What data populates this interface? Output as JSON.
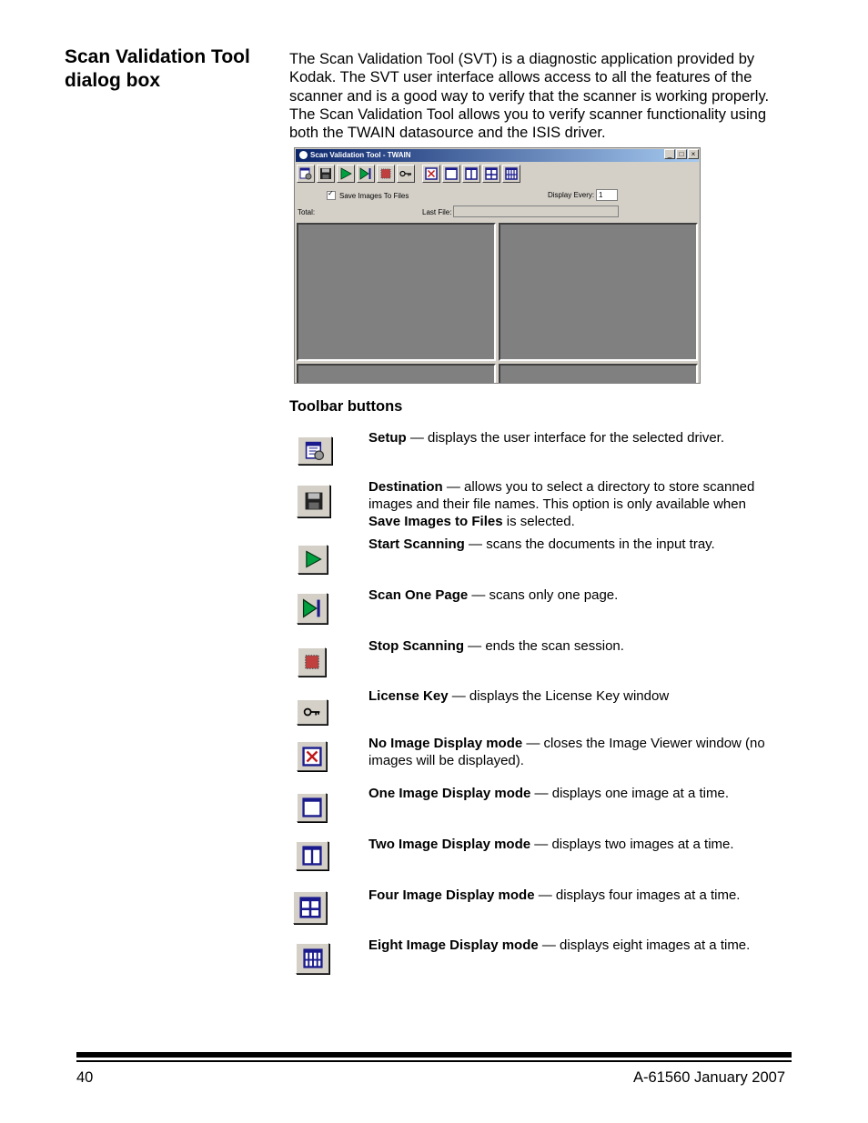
{
  "heading": "Scan Validation Tool dialog box",
  "intro": "The Scan Validation Tool (SVT) is a diagnostic application provided by Kodak. The SVT user interface allows access to all the features of the scanner and is a good way to verify that the scanner is working properly. The Scan Validation Tool allows you to verify scanner functionality using both the TWAIN datasource and the ISIS driver.",
  "window": {
    "title": "Scan Validation Tool - TWAIN",
    "minimize": "_",
    "maximize": "□",
    "close": "×",
    "save_images_label": "Save Images To Files",
    "display_every_label": "Display Every:",
    "display_every_value": "1",
    "total_label": "Total:",
    "last_file_label": "Last File:"
  },
  "subheading": "Toolbar buttons",
  "buttons": [
    {
      "icon": "setup-icon",
      "name": "Setup",
      "desc": " — displays the user interface for the selected driver."
    },
    {
      "icon": "floppy-disk-icon",
      "name": "Destination",
      "desc": " — allows you to select a directory to store scanned images and their file names. This option is only available when ",
      "name2": "Save Images to Files",
      "desc2": " is selected."
    },
    {
      "icon": "play-icon",
      "name": "Start Scanning",
      "desc": " — scans the documents in the input tray."
    },
    {
      "icon": "step-forward-icon",
      "name": "Scan One Page",
      "desc": " — scans only one page."
    },
    {
      "icon": "stop-icon",
      "name": "Stop Scanning",
      "desc": " — ends the scan session."
    },
    {
      "icon": "key-icon",
      "name": "License Key",
      "desc": " — displays the License Key window"
    },
    {
      "icon": "no-image-icon",
      "name": "No Image Display mode",
      "desc": " — closes the Image Viewer window (no images will be displayed)."
    },
    {
      "icon": "one-image-icon",
      "name": "One Image Display mode",
      "desc": " — displays one image at a time."
    },
    {
      "icon": "two-image-icon",
      "name": "Two Image Display mode",
      "desc": " — displays two images at a time."
    },
    {
      "icon": "four-image-icon",
      "name": "Four Image Display mode",
      "desc": " — displays four images at a time."
    },
    {
      "icon": "eight-image-icon",
      "name": "Eight Image Display mode",
      "desc": " — displays eight images at a time."
    }
  ],
  "footer": {
    "page_number": "40",
    "doc_id": "A-61560 January 2007"
  },
  "colors": {
    "icon_blue": "#1a1a8c",
    "icon_green": "#00a040",
    "icon_red": "#c01818",
    "viewer_gray": "#808080",
    "window_gray": "#d4d0c8"
  }
}
